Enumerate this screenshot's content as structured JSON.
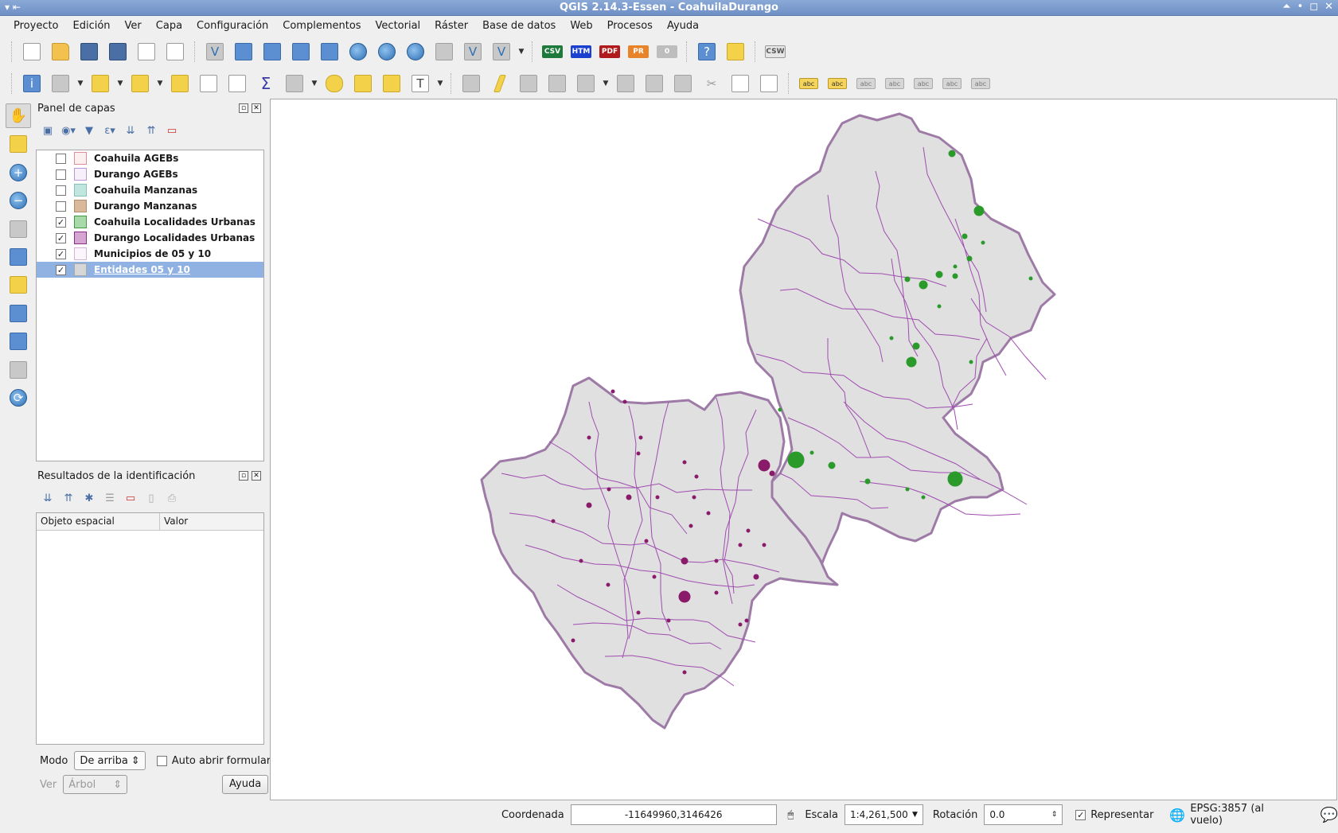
{
  "window": {
    "title": "QGIS 2.14.3-Essen - CoahuilaDurango"
  },
  "menubar": [
    "Proyecto",
    "Edición",
    "Ver",
    "Capa",
    "Configuración",
    "Complementos",
    "Vectorial",
    "Ráster",
    "Base de datos",
    "Web",
    "Procesos",
    "Ayuda"
  ],
  "toolbar1": {
    "labels": {
      "csv": "CSV",
      "htm": "HTM",
      "pdf": "PDF",
      "pr": "PR",
      "zero": "0",
      "csw": "CSW"
    }
  },
  "toolbar2": {
    "abc": "abc"
  },
  "layers_panel": {
    "title": "Panel de capas",
    "layers": [
      {
        "name": "Coahuila AGEBs",
        "checked": false,
        "color": "#fbeff0",
        "border": "#e08a9a",
        "selected": false
      },
      {
        "name": "Durango AGEBs",
        "checked": false,
        "color": "#f6f0fb",
        "border": "#b896d8",
        "selected": false
      },
      {
        "name": "Coahuila Manzanas",
        "checked": false,
        "color": "#bfe6df",
        "border": "#86c1b6",
        "selected": false
      },
      {
        "name": "Durango Manzanas",
        "checked": false,
        "color": "#d9b99a",
        "border": "#b08f6f",
        "selected": false
      },
      {
        "name": "Coahuila Localidades Urbanas",
        "checked": true,
        "color": "#a8d9a8",
        "border": "#3e9a3e",
        "selected": false
      },
      {
        "name": "Durango Localidades Urbanas",
        "checked": true,
        "color": "#d6a6d3",
        "border": "#8a2c88",
        "selected": false
      },
      {
        "name": "Municipios de 05 y 10",
        "checked": true,
        "color": "#fbf6fb",
        "border": "#d6b3d6",
        "selected": false
      },
      {
        "name": "Entidades 05 y 10",
        "checked": true,
        "color": "#d7d7d7",
        "border": "#a9a9a9",
        "selected": true
      }
    ]
  },
  "results_panel": {
    "title": "Resultados de la identificación",
    "col_feature": "Objeto espacial",
    "col_value": "Valor",
    "mode_label": "Modo",
    "mode_value": "De arriba",
    "auto_open_label": "Auto abrir formulario",
    "ver_label": "Ver",
    "ver_value": "Árbol",
    "help_button": "Ayuda"
  },
  "statusbar": {
    "coord_label": "Coordenada",
    "coord_value": "-11649960,3146426",
    "scale_label": "Escala",
    "scale_value": "1:4,261,500",
    "rotation_label": "Rotación",
    "rotation_value": "0.0",
    "render_label": "Representar",
    "crs_label": "EPSG:3857 (al vuelo)"
  },
  "colors": {
    "state_fill": "#e0e0e0",
    "state_border": "#9e7aa6",
    "municipio_line": "#a04cb0",
    "coahuila_localidad": "#2a9a2a",
    "durango_localidad": "#8a1a6a",
    "selection": "#8fb2e2"
  }
}
